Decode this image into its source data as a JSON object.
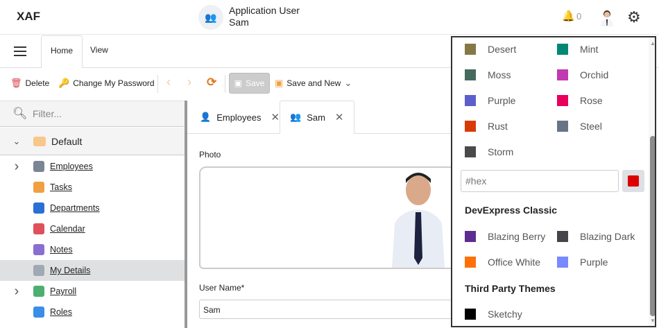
{
  "header": {
    "logo": "XAF",
    "user_title": "Application User",
    "user_name": "Sam",
    "notification_count": "0"
  },
  "ribbon": {
    "tabs": [
      "Home",
      "View"
    ]
  },
  "toolbar": {
    "delete": "Delete",
    "change_password": "Change My Password",
    "save": "Save",
    "save_and_new": "Save and New"
  },
  "sidebar": {
    "filter_placeholder": "Filter...",
    "group": "Default",
    "items": [
      {
        "label": "Employees",
        "expandable": true,
        "color": "#7a8696"
      },
      {
        "label": "Tasks",
        "expandable": false,
        "color": "#f0a040"
      },
      {
        "label": "Departments",
        "expandable": false,
        "color": "#2a6fd6"
      },
      {
        "label": "Calendar",
        "expandable": false,
        "color": "#e0505a"
      },
      {
        "label": "Notes",
        "expandable": false,
        "color": "#8a6fd0"
      },
      {
        "label": "My Details",
        "expandable": false,
        "color": "#a0a8b4",
        "selected": true
      },
      {
        "label": "Payroll",
        "expandable": true,
        "color": "#4caf70"
      },
      {
        "label": "Roles",
        "expandable": false,
        "color": "#3a8ee6"
      }
    ]
  },
  "content": {
    "tabs": [
      {
        "label": "Employees"
      },
      {
        "label": "Sam"
      }
    ],
    "photo_label": "Photo",
    "username_label": "User Name*",
    "username_value": "Sam"
  },
  "theme_dropdown": {
    "colors": [
      {
        "name": "Desert",
        "color": "#857845"
      },
      {
        "name": "Mint",
        "color": "#008875"
      },
      {
        "name": "Moss",
        "color": "#476a5f"
      },
      {
        "name": "Orchid",
        "color": "#c13ab0"
      },
      {
        "name": "Purple",
        "color": "#5b5fcb"
      },
      {
        "name": "Rose",
        "color": "#e8005c"
      },
      {
        "name": "Rust",
        "color": "#d83b01"
      },
      {
        "name": "Steel",
        "color": "#687486"
      },
      {
        "name": "Storm",
        "color": "#4a4a4a"
      }
    ],
    "hex_placeholder": "#hex",
    "picker_color": "#dd0000",
    "classic_title": "DevExpress Classic",
    "classic": [
      {
        "name": "Blazing Berry",
        "color": "#5c2d91"
      },
      {
        "name": "Blazing Dark",
        "color": "#46444a"
      },
      {
        "name": "Office White",
        "color": "#fe7109"
      },
      {
        "name": "Purple",
        "color": "#7989ff"
      }
    ],
    "third_title": "Third Party Themes",
    "third": [
      {
        "name": "Sketchy",
        "color": "#000000"
      }
    ]
  }
}
